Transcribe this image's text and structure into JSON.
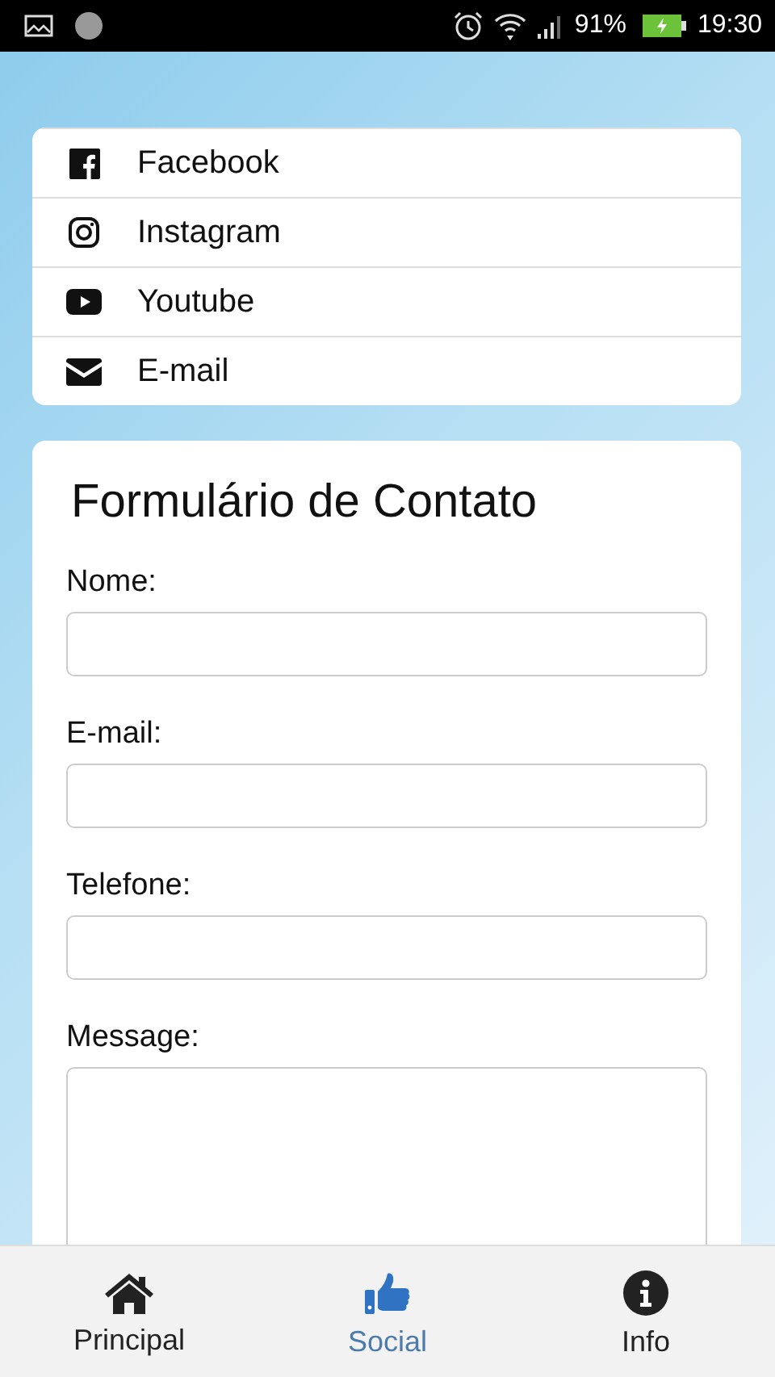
{
  "status_bar": {
    "battery": "91%",
    "time": "19:30"
  },
  "social_links": [
    {
      "kind": "facebook",
      "label": "Facebook"
    },
    {
      "kind": "instagram",
      "label": "Instagram"
    },
    {
      "kind": "youtube",
      "label": "Youtube"
    },
    {
      "kind": "email",
      "label": "E-mail"
    }
  ],
  "contact_form": {
    "title": "Formulário de Contato",
    "fields": [
      {
        "kind": "text",
        "label": "Nome:"
      },
      {
        "kind": "text",
        "label": "E-mail:"
      },
      {
        "kind": "text",
        "label": "Telefone:"
      },
      {
        "kind": "textarea",
        "label": "Message:"
      }
    ]
  },
  "bottom_nav": [
    {
      "kind": "home",
      "label": "Principal",
      "selected": false
    },
    {
      "kind": "thumbs-up",
      "label": "Social",
      "selected": true
    },
    {
      "kind": "info",
      "label": "Info",
      "selected": false
    }
  ]
}
